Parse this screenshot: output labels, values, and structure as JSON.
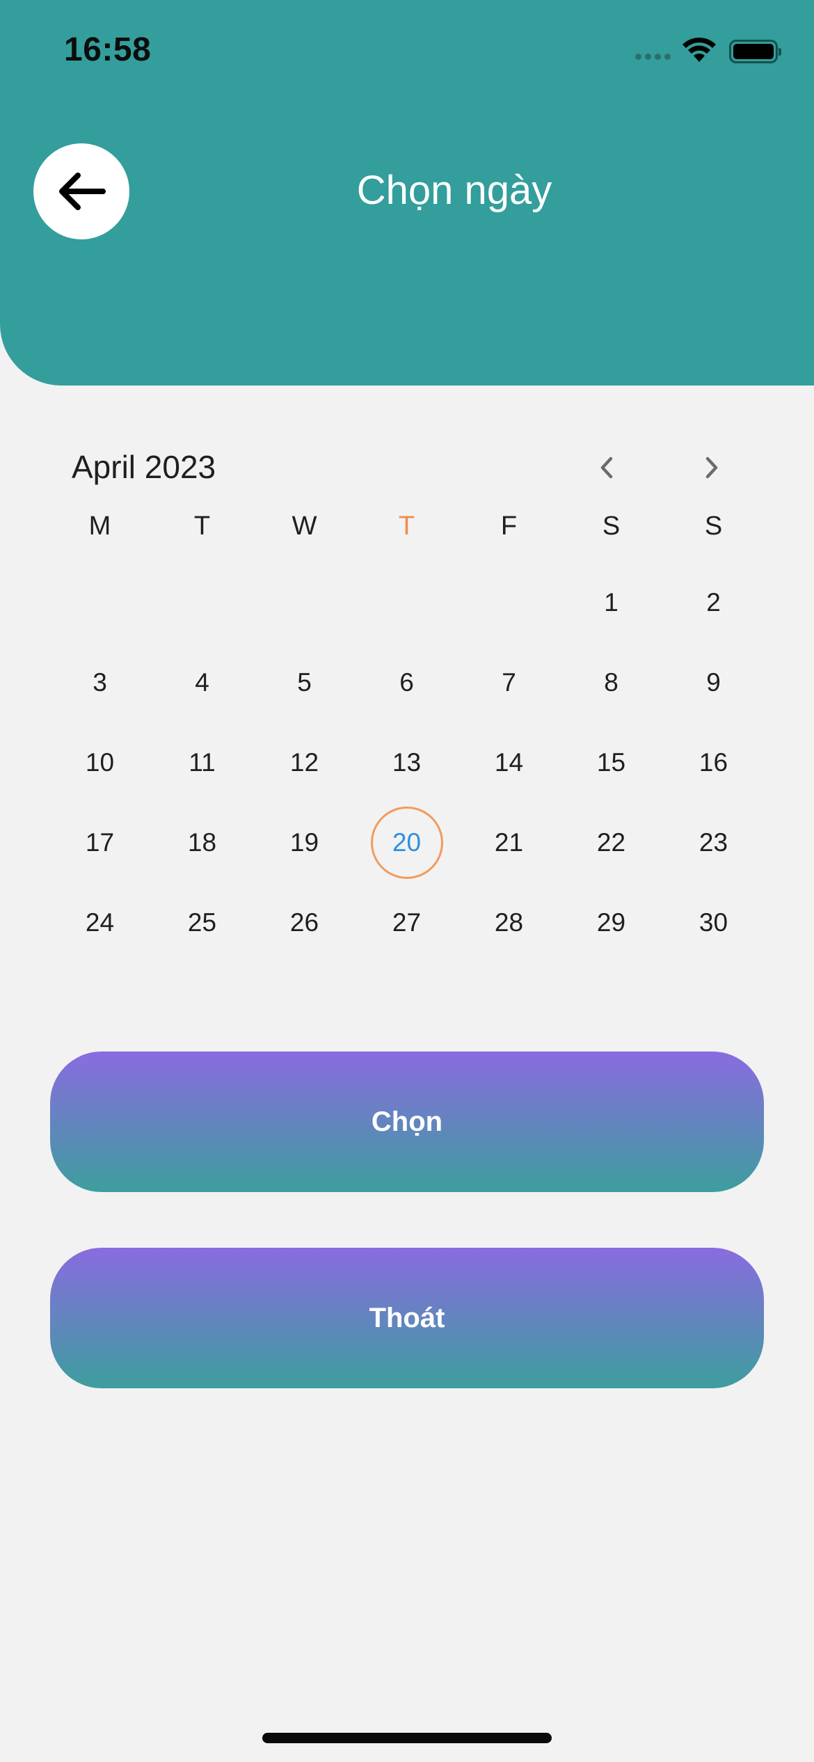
{
  "status_bar": {
    "time": "16:58",
    "icons": [
      "cellular-signal-icon",
      "wifi-icon",
      "battery-icon"
    ]
  },
  "header": {
    "title": "Chọn ngày",
    "back_icon": "arrow-left-icon",
    "background_color": "#339e9c"
  },
  "calendar": {
    "month_label": "April 2023",
    "prev_icon": "chevron-left-icon",
    "next_icon": "chevron-right-icon",
    "weekdays": [
      "M",
      "T",
      "W",
      "T",
      "F",
      "S",
      "S"
    ],
    "today_weekday_index": 3,
    "weeks": [
      [
        "",
        "",
        "",
        "",
        "",
        "1",
        "2"
      ],
      [
        "3",
        "4",
        "5",
        "6",
        "7",
        "8",
        "9"
      ],
      [
        "10",
        "11",
        "12",
        "13",
        "14",
        "15",
        "16"
      ],
      [
        "17",
        "18",
        "19",
        "20",
        "21",
        "22",
        "23"
      ],
      [
        "24",
        "25",
        "26",
        "27",
        "28",
        "29",
        "30"
      ]
    ],
    "today": "20",
    "today_ring_color": "#f29b5e",
    "today_text_color": "#2f8fe0"
  },
  "actions": {
    "choose_label": "Chọn",
    "exit_label": "Thoát",
    "gradient_top": "#8a6be0",
    "gradient_bottom": "#3d9e9e"
  }
}
